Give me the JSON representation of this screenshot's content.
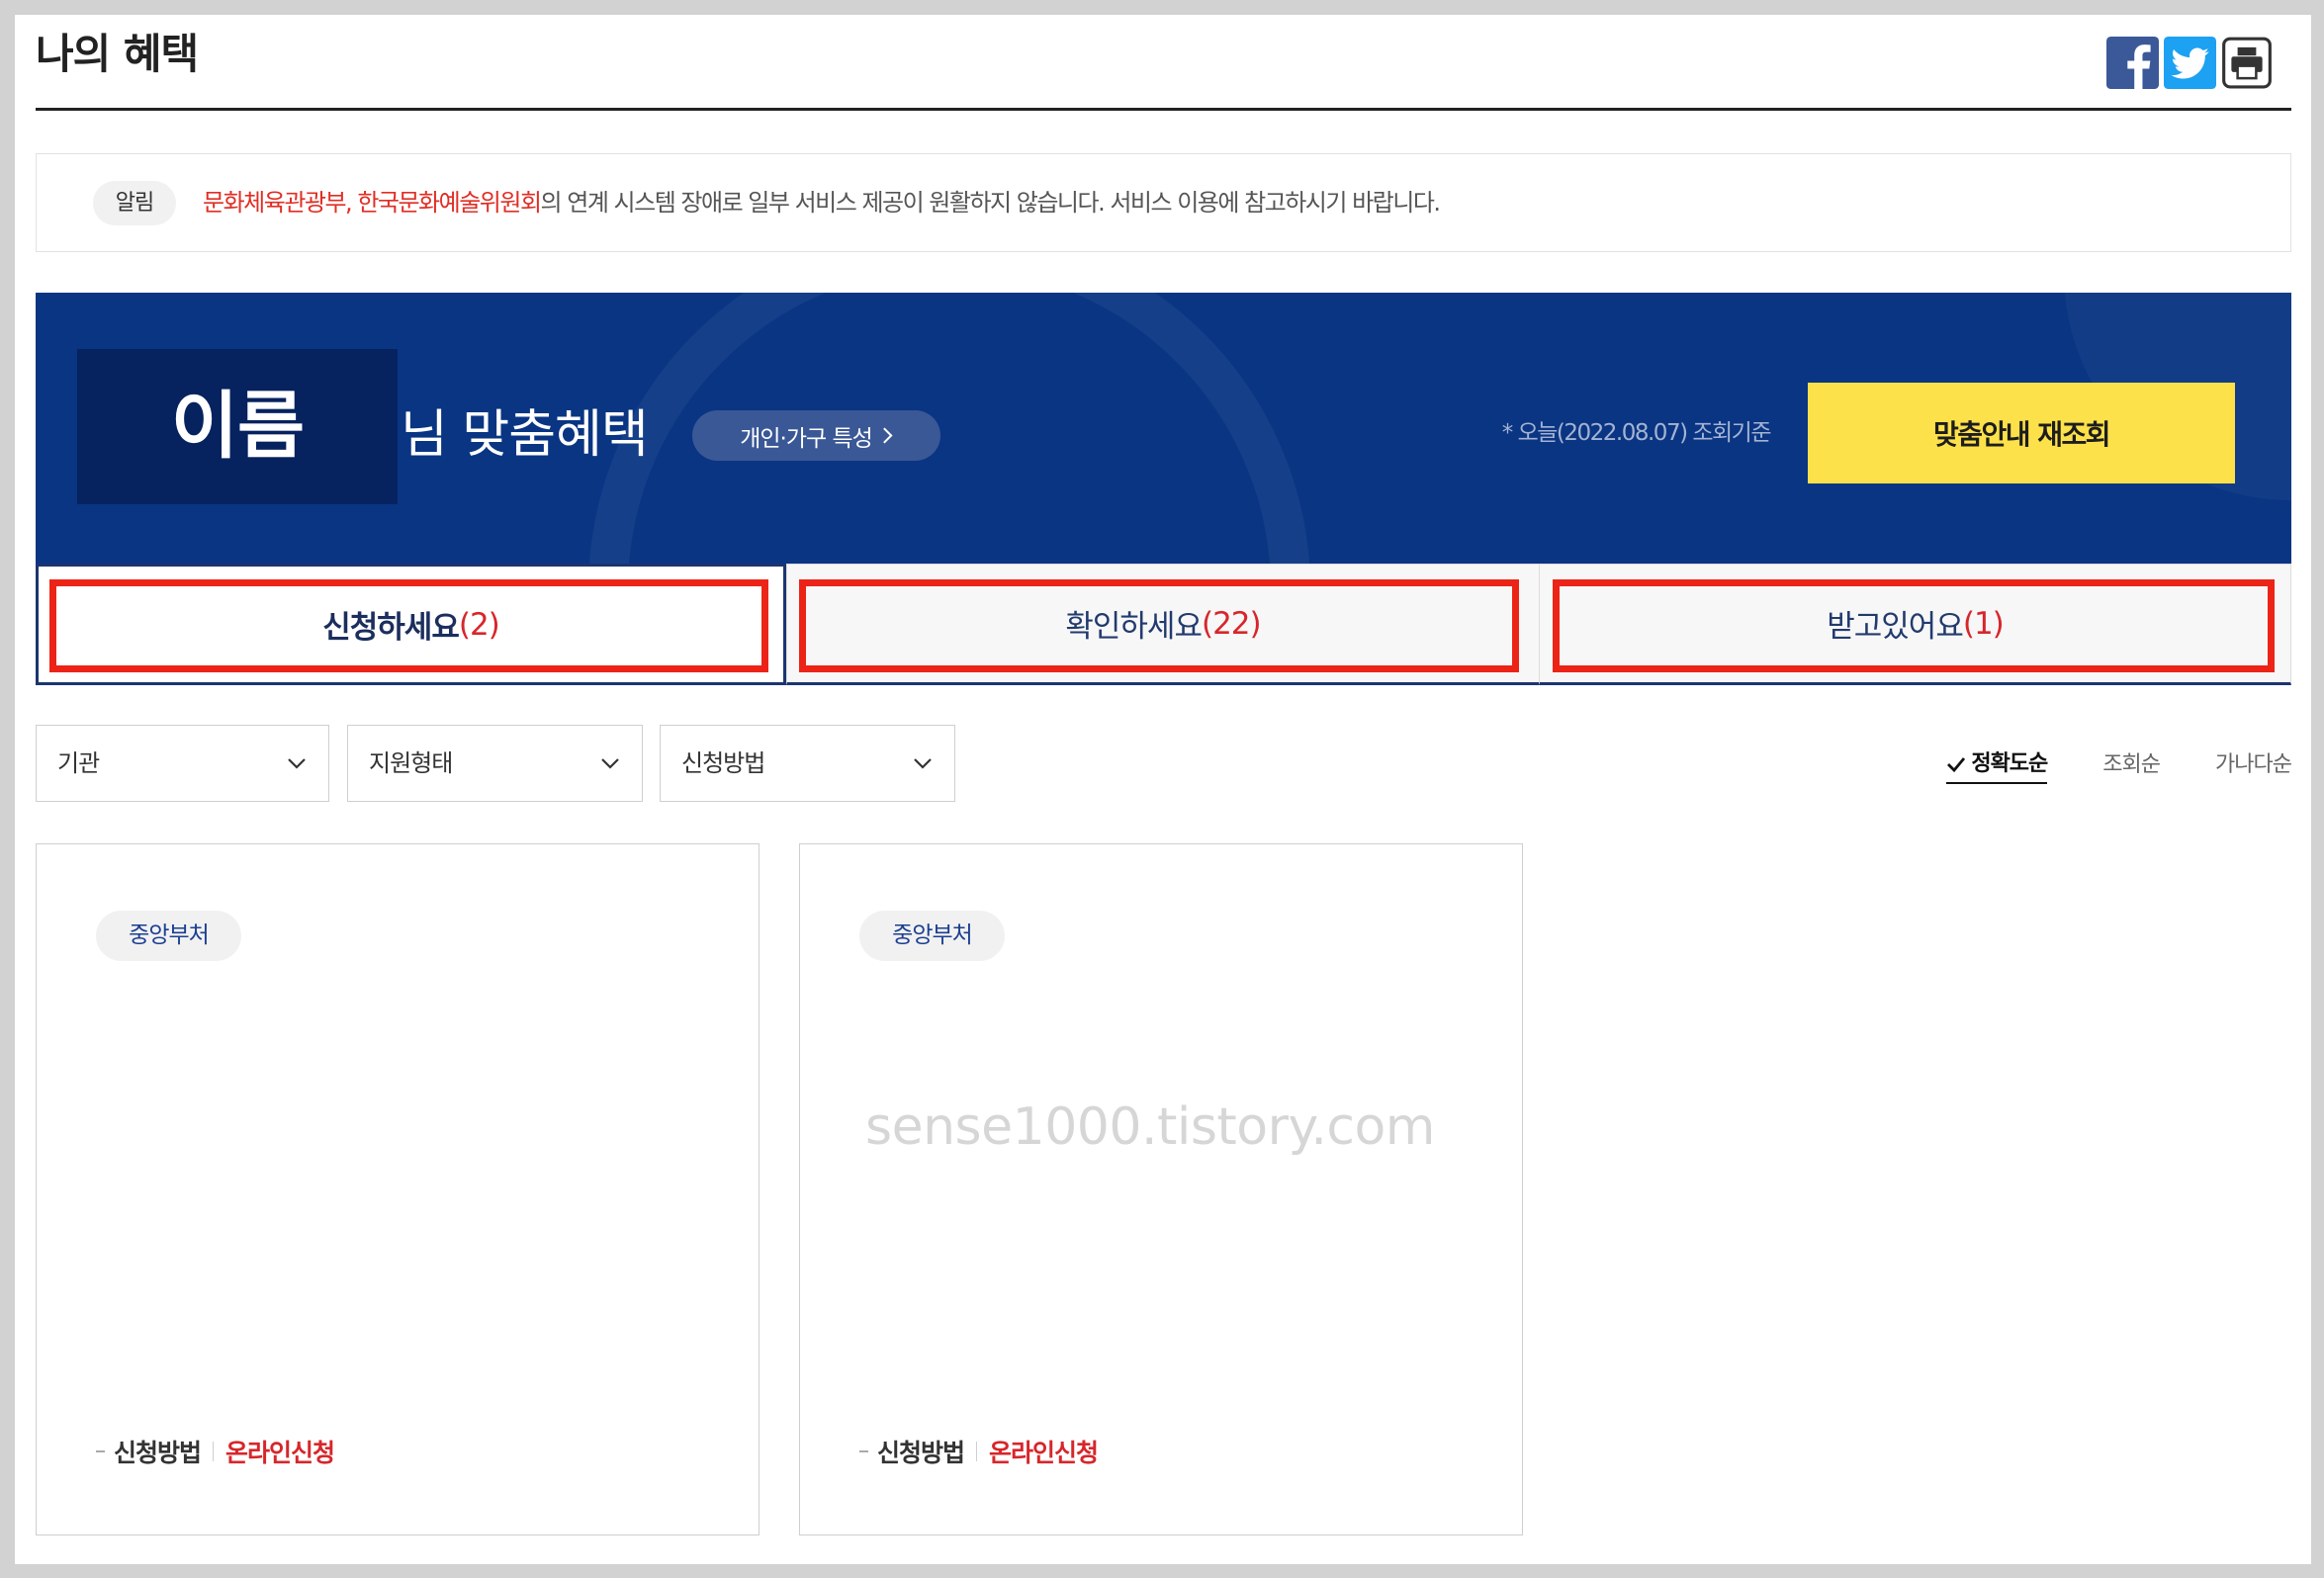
{
  "page": {
    "title": "나의 혜택"
  },
  "share_icons": [
    "facebook-icon",
    "twitter-icon",
    "print-icon"
  ],
  "notice": {
    "badge": "알림",
    "highlight": "문화체육관광부, 한국문화예술위원회",
    "message": "의 연계 시스템 장애로 일부 서비스 제공이 원활하지 않습니다. 서비스 이용에 참고하시기 바랍니다."
  },
  "banner": {
    "user_name": "이름",
    "title_suffix": "님 맞춤혜택",
    "traits_button": "개인·가구 특성",
    "traits_icon": "chevron-right-icon",
    "date_note": "* 오늘(2022.08.07) 조회기준",
    "refresh_button": "맞춤안내 재조회"
  },
  "tabs": [
    {
      "label": "신청하세요",
      "count": "(2)",
      "active": true
    },
    {
      "label": "확인하세요",
      "count": "(22)",
      "active": false
    },
    {
      "label": "받고있어요",
      "count": "(1)",
      "active": false
    }
  ],
  "filters": [
    {
      "label": "기관",
      "icon": "chevron-down-icon"
    },
    {
      "label": "지원형태",
      "icon": "chevron-down-icon"
    },
    {
      "label": "신청방법",
      "icon": "chevron-down-icon"
    }
  ],
  "sort": [
    {
      "label": "정확도순",
      "selected": true,
      "icon": "check-icon"
    },
    {
      "label": "조회순",
      "selected": false
    },
    {
      "label": "가나다순",
      "selected": false
    }
  ],
  "cards": [
    {
      "category": "중앙부처",
      "method_label": "신청방법",
      "method_value": "온라인신청"
    },
    {
      "category": "중앙부처",
      "method_label": "신청방법",
      "method_value": "온라인신청"
    }
  ],
  "watermark": "sense1000.tistory.com",
  "colors": {
    "banner_navy": "#0a3583",
    "name_box": "#06225f",
    "refresh_yellow": "#fde14a",
    "annotation_red": "#ec2417",
    "count_red": "#d7262b",
    "tab_border_navy": "#1b3570"
  }
}
